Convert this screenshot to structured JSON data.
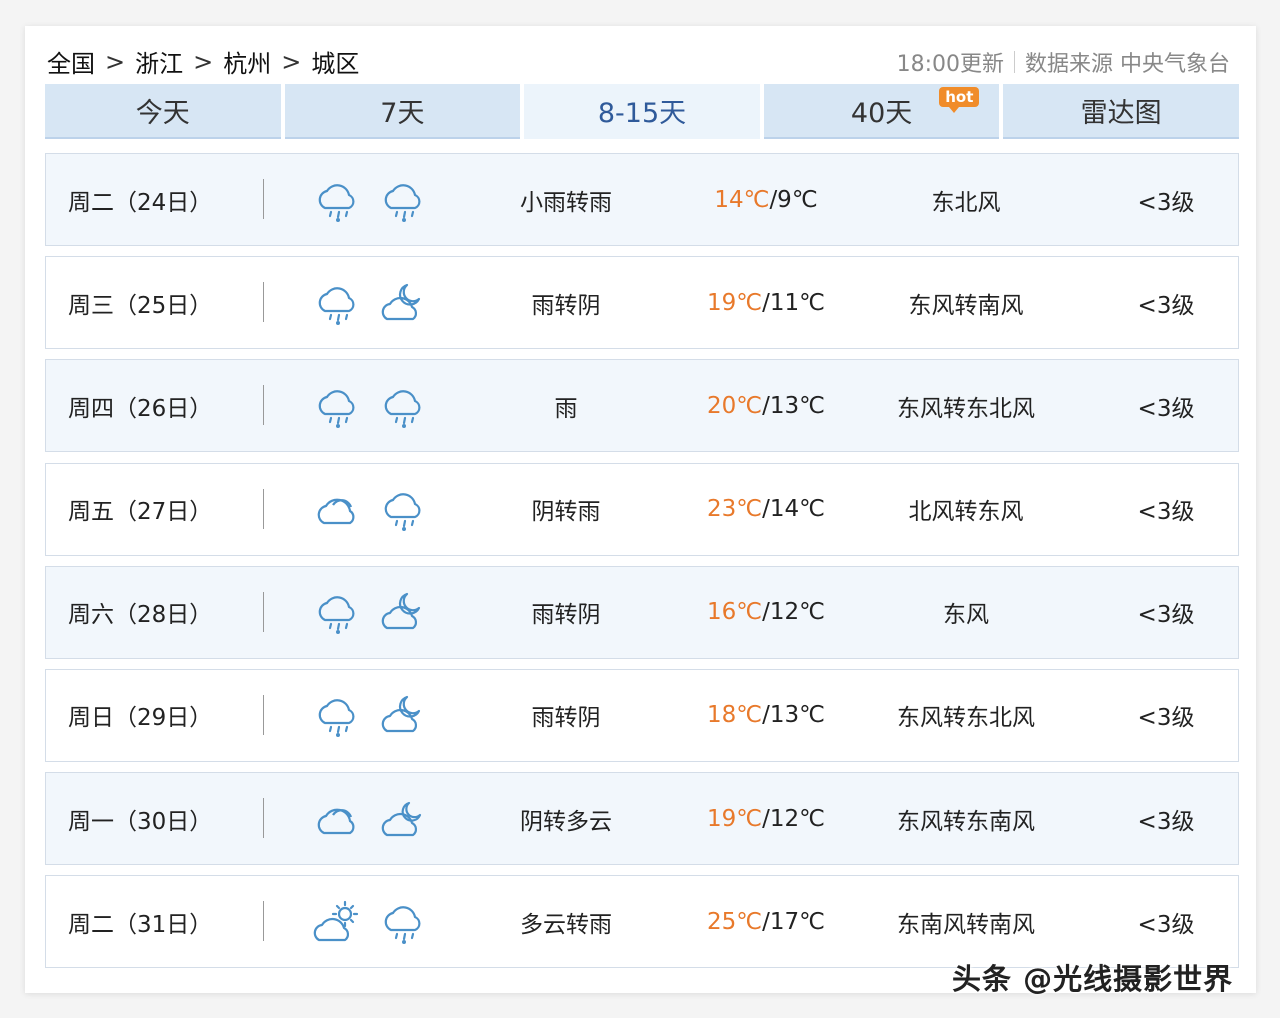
{
  "breadcrumb": {
    "country": "全国",
    "province": "浙江",
    "city": "杭州",
    "district": "城区",
    "separator": ">"
  },
  "source": {
    "update": "18:00更新",
    "label": "数据来源 中央气象台"
  },
  "tabs": [
    {
      "label": "今天"
    },
    {
      "label": "7天"
    },
    {
      "label": "8-15天"
    },
    {
      "label": "40天",
      "badge": "hot"
    },
    {
      "label": "雷达图"
    }
  ],
  "active_tab": "8-15天",
  "forecast": [
    {
      "day": "周二（24日）",
      "icons": [
        "rain-icon",
        "rain-icon"
      ],
      "desc": "小雨转雨",
      "hi": "14℃",
      "lo": "/9℃",
      "wind": "东北风",
      "level": "<3级"
    },
    {
      "day": "周三（25日）",
      "icons": [
        "rain-icon",
        "cloudy-night-icon"
      ],
      "desc": "雨转阴",
      "hi": "19℃",
      "lo": "/11℃",
      "wind": "东风转南风",
      "level": "<3级"
    },
    {
      "day": "周四（26日）",
      "icons": [
        "rain-icon",
        "rain-icon"
      ],
      "desc": "雨",
      "hi": "20℃",
      "lo": "/13℃",
      "wind": "东风转东北风",
      "level": "<3级"
    },
    {
      "day": "周五（27日）",
      "icons": [
        "overcast-icon",
        "rain-icon"
      ],
      "desc": "阴转雨",
      "hi": "23℃",
      "lo": "/14℃",
      "wind": "北风转东风",
      "level": "<3级"
    },
    {
      "day": "周六（28日）",
      "icons": [
        "rain-icon",
        "cloudy-night-icon"
      ],
      "desc": "雨转阴",
      "hi": "16℃",
      "lo": "/12℃",
      "wind": "东风",
      "level": "<3级"
    },
    {
      "day": "周日（29日）",
      "icons": [
        "rain-icon",
        "cloudy-night-icon"
      ],
      "desc": "雨转阴",
      "hi": "18℃",
      "lo": "/13℃",
      "wind": "东风转东北风",
      "level": "<3级"
    },
    {
      "day": "周一（30日）",
      "icons": [
        "overcast-icon",
        "partly-cloudy-night-icon"
      ],
      "desc": "阴转多云",
      "hi": "19℃",
      "lo": "/12℃",
      "wind": "东风转东南风",
      "level": "<3级"
    },
    {
      "day": "周二（31日）",
      "icons": [
        "partly-cloudy-day-icon",
        "rain-icon"
      ],
      "desc": "多云转雨",
      "hi": "25℃",
      "lo": "/17℃",
      "wind": "东南风转南风",
      "level": "<3级"
    }
  ],
  "watermark": "头条 @光线摄影世界",
  "colors": {
    "high_temp": "#e8792b",
    "tab_bg": "#d7e6f4",
    "tab_active_text": "#2f5a9a",
    "icon_blue": "#4a90c8"
  }
}
